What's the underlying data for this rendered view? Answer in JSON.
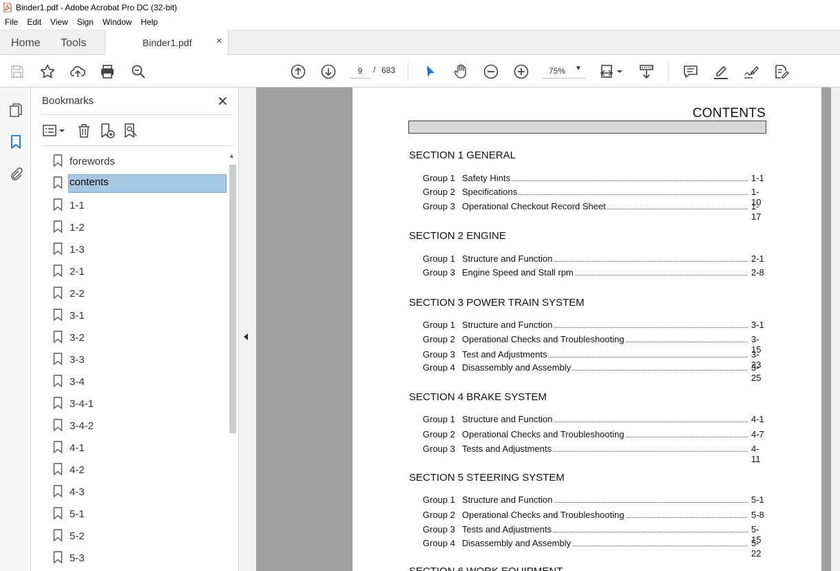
{
  "window": {
    "title": "Binder1.pdf - Adobe Acrobat Pro DC (32-bit)"
  },
  "menu": [
    "File",
    "Edit",
    "View",
    "Sign",
    "Window",
    "Help"
  ],
  "tabs": {
    "home": "Home",
    "tools": "Tools",
    "document": "Binder1.pdf",
    "close": "×"
  },
  "toolbar": {
    "page_current": "9",
    "page_sep": "/",
    "page_total": "683",
    "zoom": "75%"
  },
  "bookmarks": {
    "title": "Bookmarks",
    "close": "✕",
    "items": [
      "forewords",
      "contents",
      "1-1",
      "1-2",
      "1-3",
      "2-1",
      "2-2",
      "3-1",
      "3-2",
      "3-3",
      "3-4",
      "3-4-1",
      "3-4-2",
      "4-1",
      "4-2",
      "4-3",
      "5-1",
      "5-2",
      "5-3"
    ],
    "selected_index": 1
  },
  "document": {
    "title": "CONTENTS",
    "sections": [
      {
        "heading": "SECTION 1  GENERAL",
        "rows": [
          {
            "group": "Group   1",
            "text": "Safety Hints",
            "page": "1-1"
          },
          {
            "group": "Group   2",
            "text": "Specifications",
            "page": "1-10"
          },
          {
            "group": "Group   3",
            "text": "Operational Checkout Record Sheet",
            "page": "1-17"
          }
        ]
      },
      {
        "heading": "SECTION 2  ENGINE",
        "rows": [
          {
            "group": "Group   1",
            "text": "Structure and Function",
            "page": "2-1"
          },
          {
            "group": "Group   3",
            "text": "Engine Speed and Stall rpm",
            "page": "2-8"
          }
        ]
      },
      {
        "heading": "SECTION 3  POWER TRAIN SYSTEM",
        "rows": [
          {
            "group": "Group   1",
            "text": "Structure and Function",
            "page": "3-1"
          },
          {
            "group": "Group   2",
            "text": "Operational Checks and Troubleshooting",
            "page": "3-15"
          },
          {
            "group": "Group   3",
            "text": "Test and Adjustments",
            "page": "3-23"
          },
          {
            "group": "Group   4",
            "text": "Disassembly and Assembly",
            "page": "3-25"
          }
        ]
      },
      {
        "heading": "SECTION 4  BRAKE SYSTEM",
        "rows": [
          {
            "group": "Group   1",
            "text": "Structure and Function",
            "page": "4-1"
          },
          {
            "group": "Group   2",
            "text": "Operational Checks and Troubleshooting",
            "page": "4-7"
          },
          {
            "group": "Group   3",
            "text": "Tests and Adjustments",
            "page": "4-11"
          }
        ]
      },
      {
        "heading": "SECTION 5  STEERING SYSTEM",
        "rows": [
          {
            "group": "Group   1",
            "text": "Structure and Function",
            "page": "5-1"
          },
          {
            "group": "Group   2",
            "text": "Operational Checks and Troubleshooting",
            "page": "5-8"
          },
          {
            "group": "Group   3",
            "text": "Tests and Adjustments",
            "page": "5-15"
          },
          {
            "group": "Group   4",
            "text": "Disassembly and Assembly",
            "page": "5-22"
          }
        ]
      },
      {
        "heading": "SECTION 6  WORK EQUIPMENT",
        "rows": []
      }
    ]
  },
  "icons": {
    "toolbar": [
      "save-icon",
      "star-icon",
      "upload-icon",
      "print-icon",
      "zoom-search-icon",
      "prev-page-icon",
      "next-page-icon",
      "select-cursor-icon",
      "hand-icon",
      "zoom-out-icon",
      "zoom-in-icon",
      "page-fit-icon",
      "scroll-mode-icon",
      "comment-icon",
      "highlight-icon",
      "sign-icon",
      "fill-sign-icon"
    ],
    "rail": [
      "pages-icon",
      "bookmark-icon",
      "attachment-icon"
    ]
  },
  "colors": {
    "selection": "#a6c8e3",
    "accent": "#1473e6"
  }
}
